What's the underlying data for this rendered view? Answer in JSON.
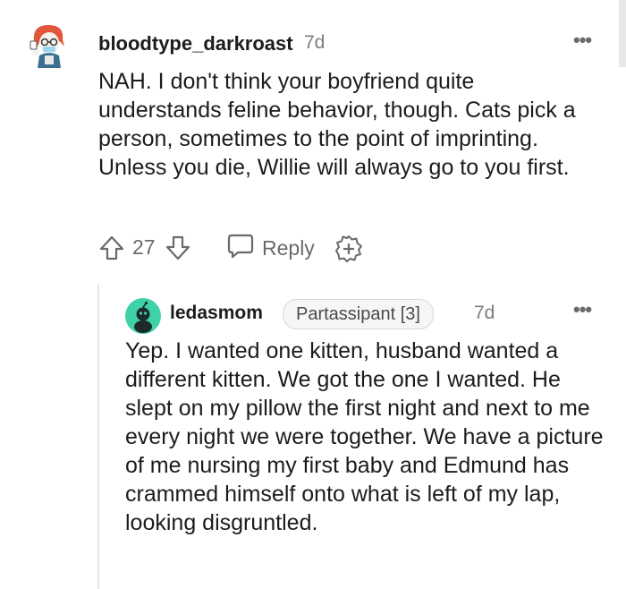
{
  "comments": [
    {
      "username": "bloodtype_darkroast",
      "age": "7d",
      "body": "NAH. I don't think your boyfriend quite understands feline behavior, though. Cats pick a person, sometimes to the point of imprinting. Unless you die, Willie will always go to you first.",
      "votes": "27",
      "reply_label": "Reply",
      "more_label": "•••"
    },
    {
      "username": "ledasmom",
      "flair": "Partassipant [3]",
      "age": "7d",
      "body": "Yep. I wanted one kitten, husband wanted a different kitten. We got the one I wanted. He slept on my pillow the first night and next to me every night we were together. We have a picture of me nursing my first baby and Edmund has crammed himself onto what is left of my lap, looking disgruntled.",
      "more_label": "•••"
    }
  ],
  "icons": {
    "upvote": "arrow-up-icon",
    "downvote": "arrow-down-icon",
    "reply": "speech-bubble-icon",
    "award": "award-plus-icon",
    "more": "more-dots-icon"
  },
  "colors": {
    "text": "#1c1c1c",
    "meta": "#7c7c7c",
    "action": "#6a6a6a",
    "thread_line": "#e4e4e4",
    "avatar2_bg": "#3fd1a8"
  }
}
